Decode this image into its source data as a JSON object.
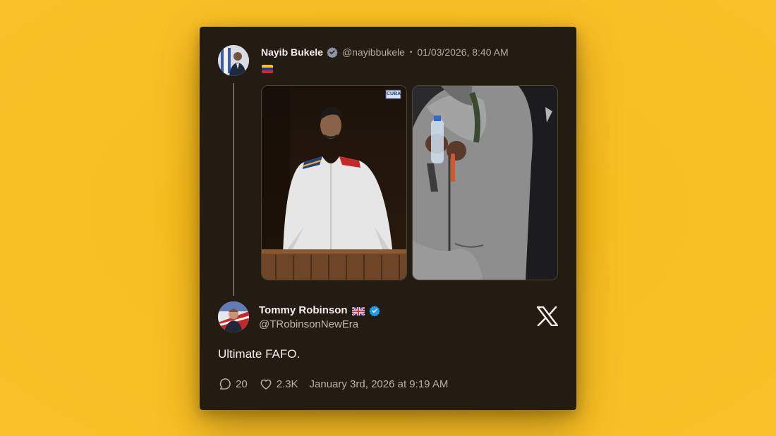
{
  "quoted_tweet": {
    "author_name": "Nayib Bukele",
    "author_handle": "@nayibbukele",
    "separator": "•",
    "timestamp": "01/03/2026, 8:40 AM",
    "content_emoji": "venezuela-flag-icon",
    "media": [
      {
        "description_name": "media-left",
        "badge": "CUBA"
      },
      {
        "description_name": "media-right"
      }
    ]
  },
  "tweet": {
    "author_name": "Tommy Robinson",
    "author_flag": "uk-flag-icon",
    "author_handle": "@TRobinsonNewEra",
    "text": "Ultimate FAFO.",
    "replies": "20",
    "likes": "2.3K",
    "posted_at": "January 3rd, 2026 at 9:19 AM"
  },
  "colors": {
    "background": "#f8bf22",
    "card": "#221c12",
    "verified": "#1d9bf0",
    "muted_text": "#b3ad9f"
  },
  "icons": {
    "verified": "verified-badge-icon",
    "reply": "reply-icon",
    "like": "heart-icon",
    "brand": "x-logo-icon"
  }
}
